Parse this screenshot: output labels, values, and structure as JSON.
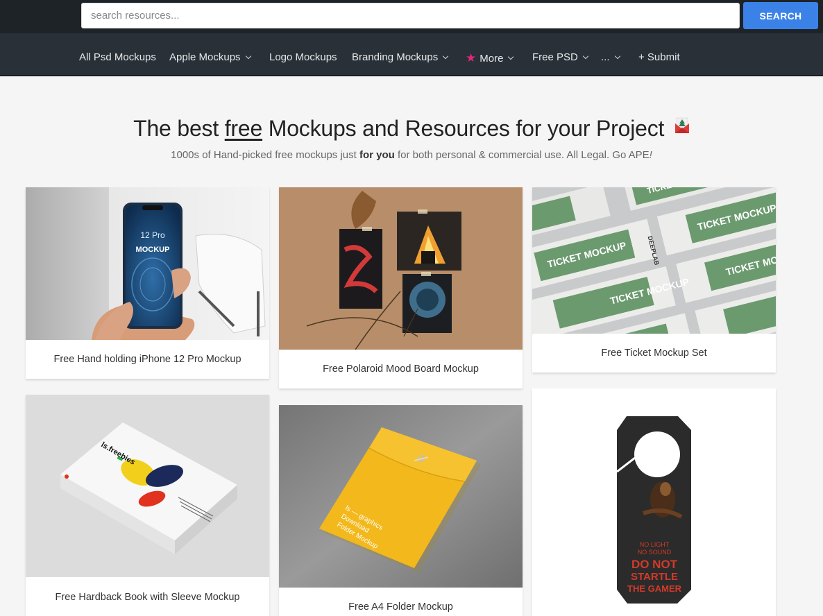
{
  "search": {
    "placeholder": "search resources...",
    "button_label": "SEARCH"
  },
  "nav": {
    "items": [
      {
        "label": "All Psd Mockups",
        "has_dropdown": false
      },
      {
        "label": "Apple Mockups",
        "has_dropdown": true
      },
      {
        "label": "Logo Mockups",
        "has_dropdown": false
      },
      {
        "label": "Branding Mockups",
        "has_dropdown": true
      },
      {
        "label": "More",
        "has_dropdown": true,
        "icon": "star-icon"
      },
      {
        "label": "Free PSD",
        "has_dropdown": true
      },
      {
        "label": "...",
        "has_dropdown": true
      },
      {
        "label": "+ Submit",
        "has_dropdown": false
      }
    ]
  },
  "hero": {
    "title_pre": "The best ",
    "title_emph": "free",
    "title_post": " Mockups and Resources for your Project",
    "subtitle_pre": "1000s of Hand-picked free mockups just ",
    "subtitle_bold": "for you",
    "subtitle_post": " for both personal & commercial use. All Legal. Go APE",
    "subtitle_end": "!"
  },
  "cards": [
    {
      "title": "Free Hand holding iPhone 12 Pro Mockup",
      "image": "iphone-mockup",
      "phone_text_1": "12 Pro",
      "phone_text_2": "MOCKUP"
    },
    {
      "title": "Free Polaroid Mood Board Mockup",
      "image": "polaroid-mockup"
    },
    {
      "title": "Free Ticket Mockup Set",
      "image": "ticket-mockup",
      "ticket_text": "TICKET MOCKUP",
      "ticket_brand": "DEEPLAB"
    },
    {
      "title": "Free Hardback Book with Sleeve Mockup",
      "image": "book-mockup",
      "book_text": "ls.freebies"
    },
    {
      "title": "Free A4 Folder Mockup",
      "image": "folder-mockup",
      "folder_text_1": "ls — graphics",
      "folder_text_2": "Download",
      "folder_text_3": "Folder Mockup"
    },
    {
      "title": "",
      "image": "door-hanger-mockup",
      "hanger_text_1": "NO LIGHT",
      "hanger_text_2": "NO SOUND",
      "hanger_text_3": "DO NOT",
      "hanger_text_4": "STARTLE",
      "hanger_text_5": "THE GAMER"
    }
  ],
  "colors": {
    "accent": "#3b82e8",
    "nav_bg": "#2a3038",
    "star": "#e0287b"
  }
}
